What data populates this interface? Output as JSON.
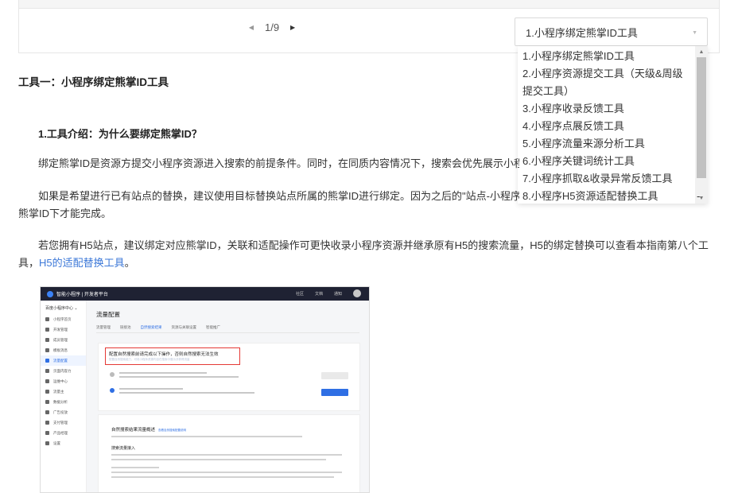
{
  "pager": {
    "prev_icon": "caret-left-icon",
    "current": "1/9",
    "next_icon": "caret-right-icon"
  },
  "select": {
    "value": "1.小程序绑定熊掌ID工具",
    "arrow_icon": "chevron-down-icon"
  },
  "dropdown": {
    "options": [
      "1.小程序绑定熊掌ID工具",
      "2.小程序资源提交工具（天级&周级提交工具）",
      "3.小程序收录反馈工具",
      "4.小程序点展反馈工具",
      "5.小程序流量来源分析工具",
      "6.小程序关键词统计工具",
      "7.小程序抓取&收录异常反馈工具",
      "8.小程序H5资源适配替换工具"
    ]
  },
  "article": {
    "title": "工具一：小程序绑定熊掌ID工具",
    "subtitle": "1.工具介绍：为什么要绑定熊掌ID？",
    "p1": "绑定熊掌ID是资源方提交小程序资源进入搜索的前提条件。同时，在同质内容情况下，搜索会优先展示小程序",
    "p2": "如果是希望进行已有站点的替换，建议使用目标替换站点所属的熊掌ID进行绑定。因为之后的\"站点-小程序\"关",
    "p2_tail": "-",
    "p2b": "熊掌ID下才能完成。",
    "p3_text": "若您拥有H5站点，建议绑定对应熊掌ID，关联和适配操作可更快收录小程序资源并继承原有H5的搜索流量，H5的绑定替换可以查看本指南第八个工具，",
    "p3_link": "H5的适配替换工具",
    "p3_end": "。"
  },
  "screenshot": {
    "brand": "智能小程序 | 开发者平台",
    "header_links": [
      "社区",
      "文档",
      "通知"
    ],
    "side_title": "百度小程序中心 ⌄",
    "side_items": [
      "小程序首页",
      "开发管理",
      "成员管理",
      "模板消息",
      "流量配置",
      "页面内容力",
      "运维中心",
      "流量主",
      "数据分析",
      "广告投放",
      "支付管理",
      "产品经理",
      "设置"
    ],
    "active_item": "流量配置",
    "page_title": "流量配置",
    "tabs": [
      "流量管理",
      "链接池",
      "自然搜索结果",
      "资源与关联设置",
      "智能推广"
    ],
    "active_tab": "自然搜索结果",
    "notice_title": "配置自然搜索前请完成以下操作，否则自然搜索无法生效",
    "notice_sub": "配置自然搜索能力，可将小程序资源内容在搜索中展示并获得流量",
    "section_title": "自然搜索结果流量概述",
    "section_link": "查看自然搜索配置说明",
    "section_sub": "搜索流量接入"
  }
}
